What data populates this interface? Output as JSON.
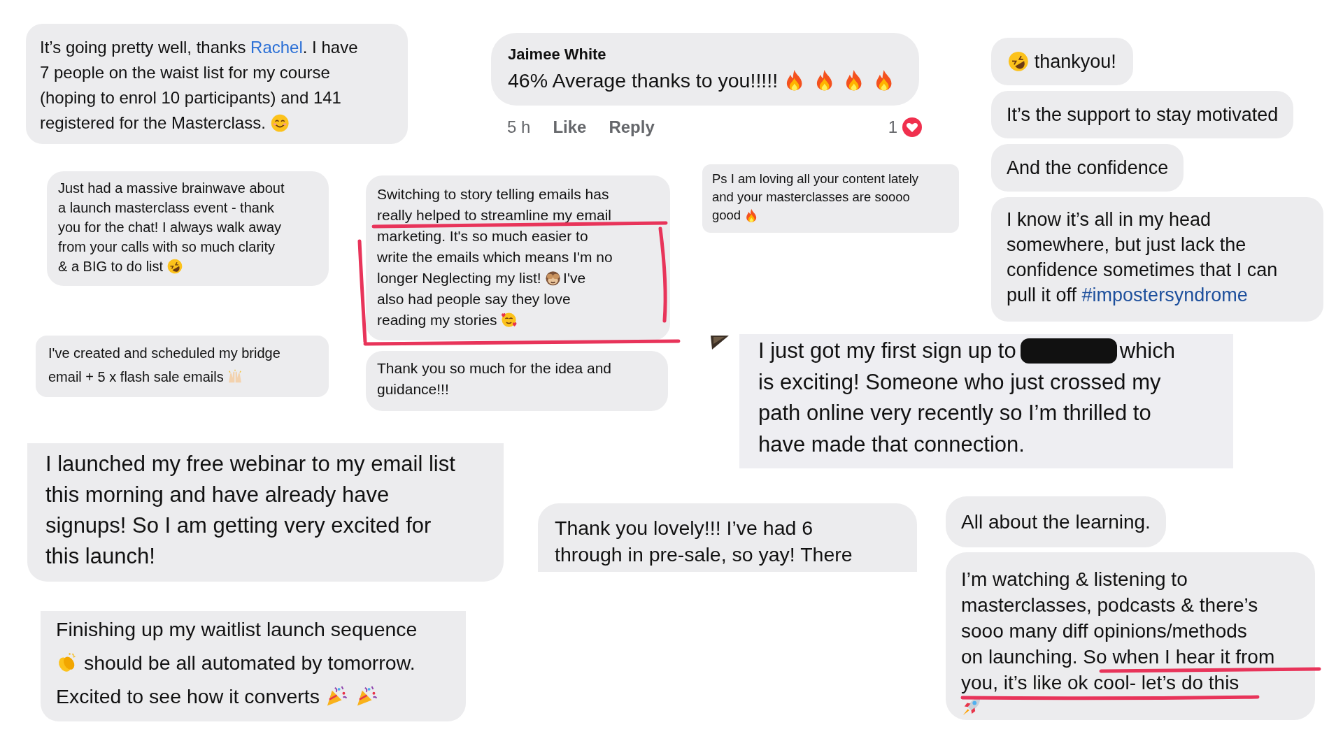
{
  "messages": [
    {
      "lines": [
        [
          {
            "kind": "text",
            "text": "It’s going pretty well, thanks "
          },
          {
            "kind": "mention",
            "text": "Rachel"
          },
          {
            "kind": "text",
            "text": ". I have"
          }
        ],
        [
          {
            "kind": "text",
            "text": "7 people on the waist list for my course"
          }
        ],
        [
          {
            "kind": "text",
            "text": "(hoping to enrol 10 participants) and 141"
          }
        ],
        [
          {
            "kind": "text",
            "text": "registered for the Masterclass."
          },
          {
            "kind": "smile"
          }
        ]
      ]
    },
    {
      "lines": [
        [
          {
            "kind": "rofl"
          },
          {
            "kind": "text",
            "text": "thankyou!"
          }
        ]
      ]
    },
    {
      "lines": [
        [
          {
            "kind": "text",
            "text": "It’s the support to stay motivated"
          }
        ]
      ]
    },
    {
      "lines": [
        [
          {
            "kind": "text",
            "text": "And the confidence"
          }
        ]
      ]
    },
    {
      "lines": [
        [
          {
            "kind": "text",
            "text": "I know it’s all in my head"
          }
        ],
        [
          {
            "kind": "text",
            "text": "somewhere, but just lack the"
          }
        ],
        [
          {
            "kind": "text",
            "text": "confidence sometimes that I can"
          }
        ],
        [
          {
            "kind": "text",
            "text": "pull it off "
          },
          {
            "kind": "hashtag",
            "text": "#impostersyndrome"
          }
        ]
      ]
    },
    {
      "lines": [
        [
          {
            "kind": "text",
            "text": "Just had a massive brainwave about"
          }
        ],
        [
          {
            "kind": "text",
            "text": "a launch masterclass event - thank"
          }
        ],
        [
          {
            "kind": "text",
            "text": "you for the chat! I always walk away"
          }
        ],
        [
          {
            "kind": "text",
            "text": "from your calls with so much clarity"
          }
        ],
        [
          {
            "kind": "text",
            "text": "& a BIG to do list"
          },
          {
            "kind": "rofl"
          }
        ]
      ]
    },
    {
      "lines": [
        [
          {
            "kind": "text",
            "text": "Switching to story telling emails has"
          }
        ],
        [
          {
            "kind": "text",
            "text": "really helped to streamline my email"
          }
        ],
        [
          {
            "kind": "text",
            "text": "marketing. It's so much easier to"
          }
        ],
        [
          {
            "kind": "text",
            "text": "write the emails which means I'm no"
          }
        ],
        [
          {
            "kind": "text",
            "text": "longer Neglecting my list!"
          },
          {
            "kind": "monkey"
          },
          {
            "kind": "text",
            "text": "I've"
          }
        ],
        [
          {
            "kind": "text",
            "text": "also had people say they love"
          }
        ],
        [
          {
            "kind": "text",
            "text": "reading my stories"
          },
          {
            "kind": "hearts"
          }
        ]
      ]
    },
    {
      "lines": [
        [
          {
            "kind": "text",
            "text": "Ps I am loving all your content lately"
          }
        ],
        [
          {
            "kind": "text",
            "text": "and your masterclasses are soooo"
          }
        ],
        [
          {
            "kind": "text",
            "text": "good"
          },
          {
            "kind": "fire"
          }
        ]
      ]
    },
    {
      "lines": [
        [
          {
            "kind": "text",
            "text": "I've created and scheduled my bridge"
          }
        ],
        [
          {
            "kind": "text",
            "text": "email + 5 x flash sale emails"
          },
          {
            "kind": "hands"
          }
        ]
      ]
    },
    {
      "lines": [
        [
          {
            "kind": "text",
            "text": "Thank you so much for the idea and"
          }
        ],
        [
          {
            "kind": "text",
            "text": "guidance!!!"
          }
        ]
      ]
    },
    {
      "lines": [
        [
          {
            "kind": "text",
            "text": "I just got my first sign up to"
          },
          {
            "kind": "redacted"
          },
          {
            "kind": "text",
            "text": "which"
          }
        ],
        [
          {
            "kind": "text",
            "text": "is exciting! Someone who just crossed my"
          }
        ],
        [
          {
            "kind": "text",
            "text": "path online very recently so I’m thrilled to"
          }
        ],
        [
          {
            "kind": "text",
            "text": "have made that connection."
          }
        ]
      ]
    },
    {
      "lines": [
        [
          {
            "kind": "text",
            "text": "I launched my free webinar to my email list"
          }
        ],
        [
          {
            "kind": "text",
            "text": "this morning and have already have"
          }
        ],
        [
          {
            "kind": "text",
            "text": "signups! So I am getting very excited for"
          }
        ],
        [
          {
            "kind": "text",
            "text": "this launch!"
          }
        ]
      ]
    },
    {
      "lines": [
        [
          {
            "kind": "text",
            "text": "Thank you lovely!!! I’ve had 6"
          }
        ],
        [
          {
            "kind": "text",
            "text": "through in pre-sale, so yay! There"
          }
        ]
      ]
    },
    {
      "lines": [
        [
          {
            "kind": "text",
            "text": "Finishing up my waitlist launch sequence"
          }
        ],
        [
          {
            "kind": "clap"
          },
          {
            "kind": "text",
            "text": "should be all automated by tomorrow."
          }
        ],
        [
          {
            "kind": "text",
            "text": "Excited to see how it converts"
          },
          {
            "kind": "party"
          },
          {
            "kind": "party"
          }
        ]
      ]
    },
    {
      "lines": [
        [
          {
            "kind": "text",
            "text": "All about the learning."
          }
        ]
      ]
    },
    {
      "lines": [
        [
          {
            "kind": "text",
            "text": "I’m watching & listening to"
          }
        ],
        [
          {
            "kind": "text",
            "text": "masterclasses, podcasts & there’s"
          }
        ],
        [
          {
            "kind": "text",
            "text": "sooo many diff opinions/methods"
          }
        ],
        [
          {
            "kind": "text",
            "text": "on launching. So when I hear it from"
          }
        ],
        [
          {
            "kind": "text",
            "text": "you, it’s like ok cool- let’s do this"
          }
        ],
        [
          {
            "kind": "rocket"
          }
        ]
      ]
    }
  ],
  "comment": {
    "author": "Jaimee White",
    "lines": [
      [
        {
          "kind": "text",
          "text": "46% Average thanks to you!!!!!"
        },
        {
          "kind": "fire"
        },
        {
          "kind": "fire"
        },
        {
          "kind": "fire"
        },
        {
          "kind": "fire"
        }
      ]
    ],
    "time": "5 h",
    "actions": [
      "Like",
      "Reply"
    ],
    "reaction_count": "1"
  }
}
